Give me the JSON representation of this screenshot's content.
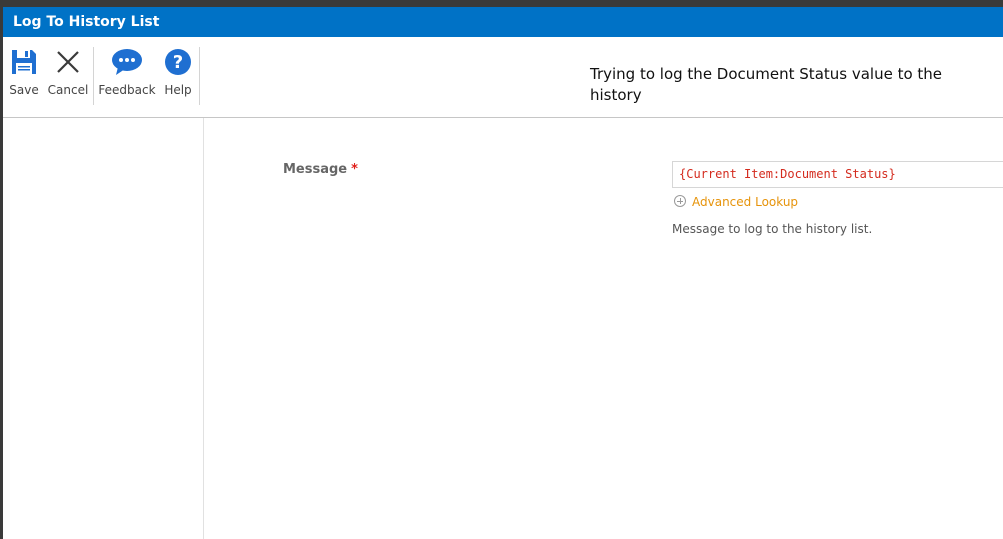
{
  "dialog": {
    "title": "Log To History List"
  },
  "toolbar": {
    "save_label": "Save",
    "cancel_label": "Cancel",
    "feedback_label": "Feedback",
    "help_label": "Help",
    "note": "Trying to log the Document Status value to the history"
  },
  "form": {
    "message_label": "Message",
    "required_marker": "*",
    "message_value": "{Current Item:Document Status}",
    "advanced_lookup_label": "Advanced Lookup",
    "help_text": "Message to log to the history list."
  },
  "colors": {
    "title_bar": "#0072c6",
    "icon_blue": "#1f6fd1",
    "lookup_orange": "#e6930a",
    "token_red": "#d42b1e"
  },
  "icons": {
    "save": "floppy-disk-icon",
    "cancel": "close-x-icon",
    "feedback": "speech-bubble-icon",
    "help": "question-circle-icon"
  }
}
